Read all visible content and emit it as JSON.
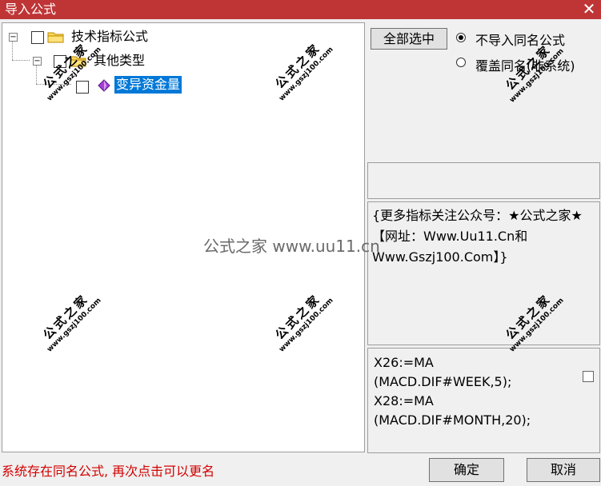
{
  "window": {
    "title": "导入公式",
    "close_glyph": "✕"
  },
  "tree": {
    "expander_glyph": "−",
    "root": {
      "label": "技术指标公式",
      "icon": "folder-icon"
    },
    "group": {
      "label": "其他类型",
      "icon": "folder-icon"
    },
    "item": {
      "label": "变异资金量",
      "icon": "formula-gem-icon",
      "selected": true
    }
  },
  "options": {
    "select_all_label": "全部选中",
    "radio_skip_label": "不导入同名公式",
    "radio_overwrite_label": "覆盖同名(非系统)",
    "selected_radio": "skip"
  },
  "description": "{更多指标关注公众号：★公式之家★ 【网址：Www.Uu11.Cn和Www.Gszj100.Com】}",
  "formula_code": "X26:=MA\n(MACD.DIF#WEEK,5);\nX28:=MA\n(MACD.DIF#MONTH,20);",
  "status_message": "系统存在同名公式, 再次点击可以更名",
  "buttons": {
    "ok_label": "确定",
    "cancel_label": "取消"
  },
  "watermarks": {
    "stamp_title": "公式之家",
    "stamp_url": "www.gszj100.com",
    "center_text": "公式之家 www.uu11.cn"
  },
  "colors": {
    "title_bar": "#bf3536",
    "selection": "#0078d7",
    "status_text": "#d40000"
  }
}
